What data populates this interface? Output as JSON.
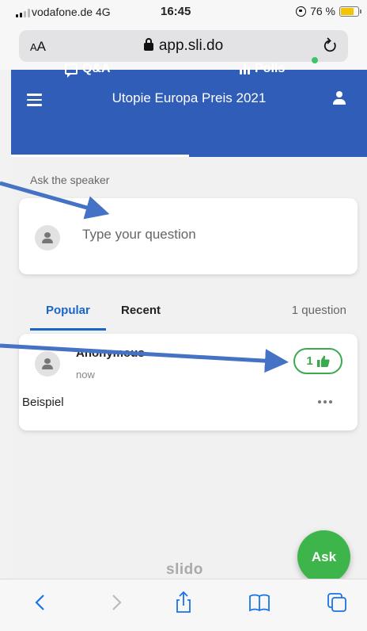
{
  "status_bar": {
    "carrier": "vodafone.de",
    "network": "4G",
    "time": "16:45",
    "battery_text": "76 %",
    "battery_level": 0.76
  },
  "browser": {
    "text_size_label": "AA",
    "url": "app.sli.do"
  },
  "app": {
    "title": "Utopie Europa Preis 2021",
    "tabs": [
      {
        "label": "Q&A",
        "active": true
      },
      {
        "label": "Polls",
        "has_new": true
      }
    ],
    "ask_label": "Ask the speaker",
    "ask_placeholder": "Type your question",
    "sort_tabs": [
      {
        "label": "Popular",
        "active": true
      },
      {
        "label": "Recent"
      }
    ],
    "question_count": "1 question",
    "questions": [
      {
        "author": "Anonymous",
        "time": "now",
        "likes": "1",
        "text": "Beispiel"
      }
    ],
    "brand": "slido",
    "ask_button": "Ask"
  },
  "colors": {
    "header_blue": "#2f5db8",
    "accent_green": "#3db54a",
    "link_blue": "#1a66c7",
    "annotation_arrow": "#4472c4"
  },
  "icons": [
    "menu-icon",
    "user-icon",
    "qa-icon",
    "polls-icon",
    "thumbs-up-icon",
    "more-icon",
    "lock-icon",
    "reload-icon",
    "back-icon",
    "forward-icon",
    "share-icon",
    "bookmarks-icon",
    "tabs-icon"
  ]
}
